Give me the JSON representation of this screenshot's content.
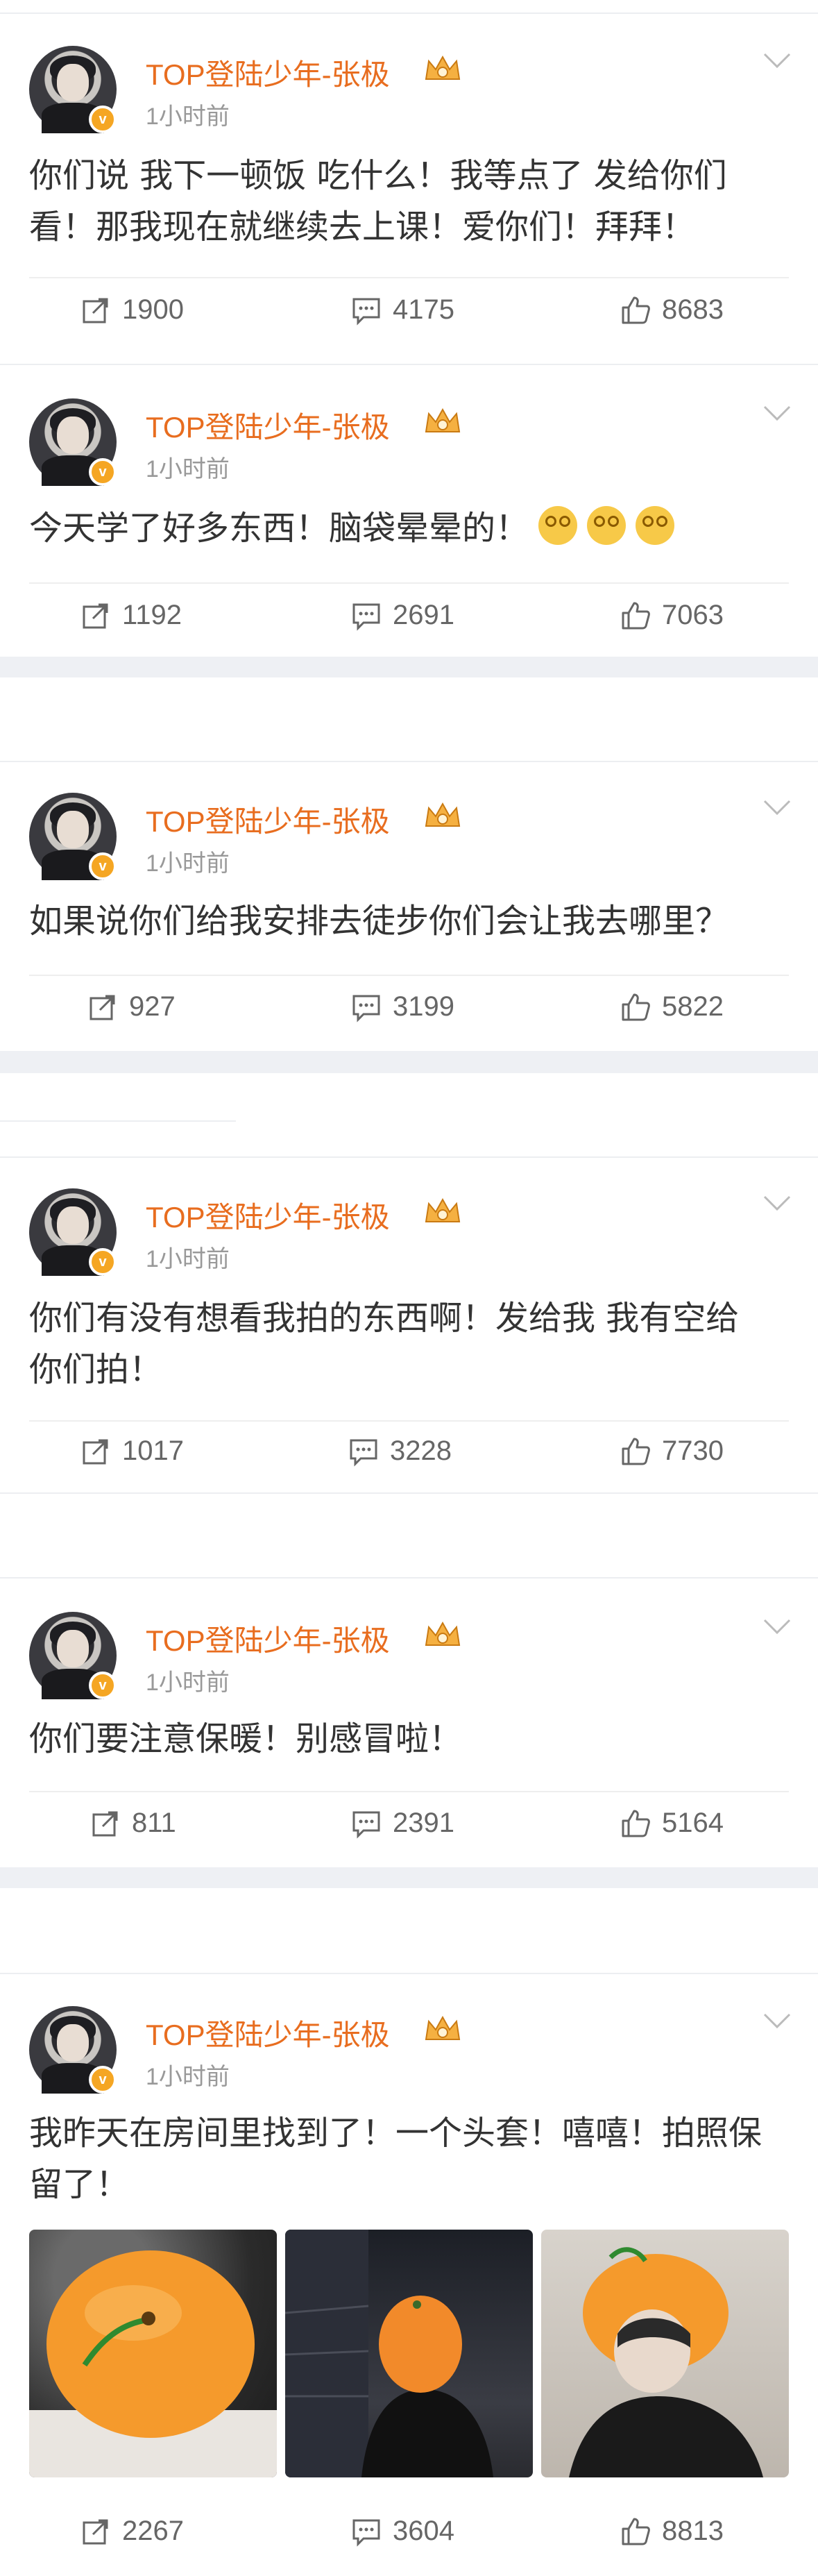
{
  "posts": [
    {
      "author": "TOP登陆少年-张极",
      "time": "1小时前",
      "text": "你们说 我下一顿饭 吃什么！我等点了 发给你们看！那我现在就继续去上课！爱你们！拜拜！",
      "repost": "1900",
      "comment": "4175",
      "like": "8683"
    },
    {
      "author": "TOP登陆少年-张极",
      "time": "1小时前",
      "text": "今天学了好多东西！脑袋晕晕的！",
      "emoji": [
        "dizzy-face-emoji",
        "dizzy-face-emoji",
        "dizzy-face-emoji"
      ],
      "repost": "1192",
      "comment": "2691",
      "like": "7063"
    },
    {
      "author": "TOP登陆少年-张极",
      "time": "1小时前",
      "text": "如果说你们给我安排去徒步你们会让我去哪里？",
      "repost": "927",
      "comment": "3199",
      "like": "5822"
    },
    {
      "author": "TOP登陆少年-张极",
      "time": "1小时前",
      "text": "你们有没有想看我拍的东西啊！发给我 我有空给你们拍！",
      "repost": "1017",
      "comment": "3228",
      "like": "7730"
    },
    {
      "author": "TOP登陆少年-张极",
      "time": "1小时前",
      "text": "你们要注意保暖！别感冒啦！",
      "repost": "811",
      "comment": "2391",
      "like": "5164"
    },
    {
      "author": "TOP登陆少年-张极",
      "time": "1小时前",
      "text": "我昨天在房间里找到了！一个头套！嘻嘻！拍照保留了！",
      "photos": [
        "orange-head-photo-closeup",
        "orange-head-photo-night",
        "orange-head-photo-selfie"
      ],
      "repost": "2267",
      "comment": "3604",
      "like": "8813"
    }
  ],
  "colors": {
    "accent": "#e86d1f",
    "badge": "#f5a623",
    "separator": "#eef0f4",
    "muted": "#999999"
  }
}
